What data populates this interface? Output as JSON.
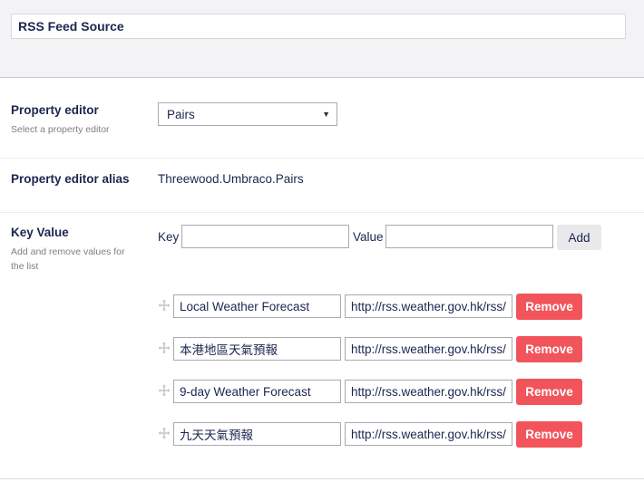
{
  "header": {
    "name_value": "RSS Feed Source"
  },
  "property_editor": {
    "label": "Property editor",
    "description": "Select a property editor",
    "selected": "Pairs"
  },
  "alias": {
    "label": "Property editor alias",
    "value": "Threewood.Umbraco.Pairs"
  },
  "key_value": {
    "label": "Key Value",
    "description": "Add and remove values for the list",
    "key_label": "Key",
    "key_value": "",
    "value_label": "Value",
    "value_value": "",
    "add_label": "Add",
    "remove_label": "Remove",
    "pairs": [
      {
        "key": "Local Weather Forecast",
        "value": "http://rss.weather.gov.hk/rss/"
      },
      {
        "key": "本港地區天氣預報",
        "value": "http://rss.weather.gov.hk/rss/"
      },
      {
        "key": "9-day Weather Forecast",
        "value": "http://rss.weather.gov.hk/rss/"
      },
      {
        "key": "九天天氣預報",
        "value": "http://rss.weather.gov.hk/rss/"
      }
    ]
  }
}
